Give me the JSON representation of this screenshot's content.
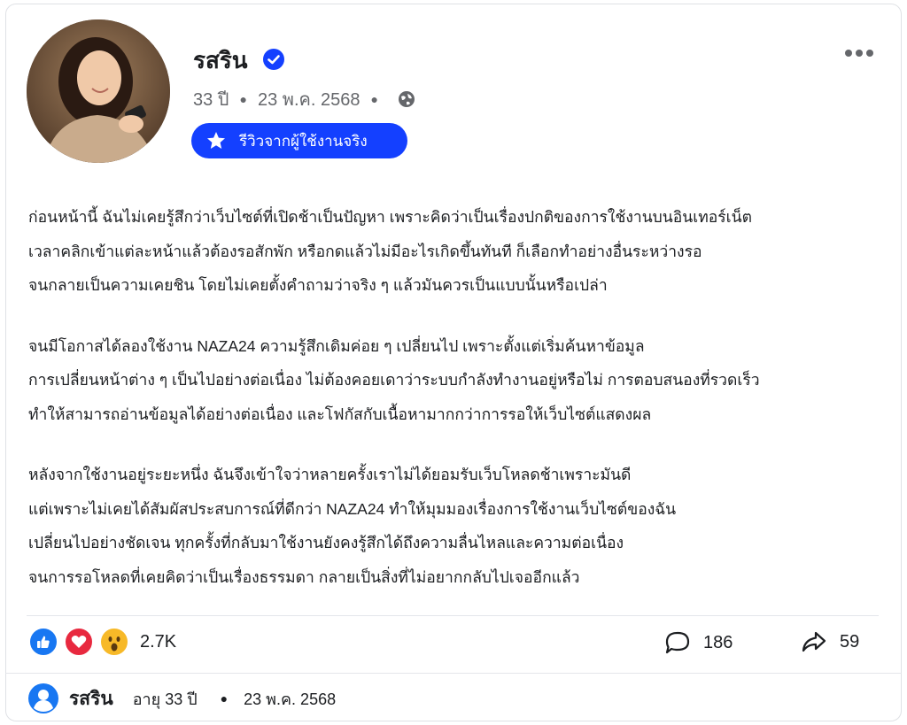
{
  "post": {
    "author_name": "รสริน",
    "age": "33 ปี",
    "date": "23 พ.ค. 2568",
    "badge_label": "รีวิวจากผู้ใช้งานจริง",
    "paragraphs": [
      [
        "ก่อนหน้านี้ ฉันไม่เคยรู้สึกว่าเว็บไซต์ที่เปิดช้าเป็นปัญหา เพราะคิดว่าเป็นเรื่องปกติของการใช้งานบนอินเทอร์เน็ต",
        "เวลาคลิกเข้าแต่ละหน้าแล้วต้องรอสักพัก หรือกดแล้วไม่มีอะไรเกิดขึ้นทันที ก็เลือกทำอย่างอื่นระหว่างรอ",
        "จนกลายเป็นความเคยชิน โดยไม่เคยตั้งคำถามว่าจริง ๆ แล้วมันควรเป็นแบบนั้นหรือเปล่า"
      ],
      [
        "จนมีโอกาสได้ลองใช้งาน NAZA24 ความรู้สึกเดิมค่อย ๆ เปลี่ยนไป เพราะตั้งแต่เริ่มค้นหาข้อมูล",
        "การเปลี่ยนหน้าต่าง ๆ เป็นไปอย่างต่อเนื่อง ไม่ต้องคอยเดาว่าระบบกำลังทำงานอยู่หรือไม่ การตอบสนองที่รวดเร็ว",
        "ทำให้สามารถอ่านข้อมูลได้อย่างต่อเนื่อง และโฟกัสกับเนื้อหามากกว่าการรอให้เว็บไซต์แสดงผล"
      ],
      [
        "หลังจากใช้งานอยู่ระยะหนึ่ง ฉันจึงเข้าใจว่าหลายครั้งเราไม่ได้ยอมรับเว็บโหลดช้าเพราะมันดี",
        "แต่เพราะไม่เคยได้สัมผัสประสบการณ์ที่ดีกว่า NAZA24 ทำให้มุมมองเรื่องการใช้งานเว็บไซต์ของฉัน",
        "เปลี่ยนไปอย่างชัดเจน ทุกครั้งที่กลับมาใช้งานยังคงรู้สึกได้ถึงความลื่นไหลและความต่อเนื่อง",
        "จนการรอโหลดที่เคยคิดว่าเป็นเรื่องธรรมดา กลายเป็นสิ่งที่ไม่อยากกลับไปเจออีกแล้ว"
      ]
    ]
  },
  "stats": {
    "reactions_count": "2.7K",
    "comments_count": "186",
    "shares_count": "59"
  },
  "footer": {
    "name": "รสริน",
    "age_label": "อายุ 33 ปี",
    "date": "23 พ.ค. 2568"
  },
  "colors": {
    "badge": "#1440ff",
    "verified": "#1440ff",
    "like": "#1877f2",
    "love": "#e8293f",
    "wow": "#f7b928",
    "footer_user_icon": "#1877f2"
  },
  "icons": {
    "verified": "verified-check-icon",
    "more": "more-options-icon",
    "privacy": "globe-icon",
    "badge": "star-icon",
    "comment": "comment-bubble-icon",
    "share": "share-arrow-icon",
    "footer_user": "user-icon"
  }
}
